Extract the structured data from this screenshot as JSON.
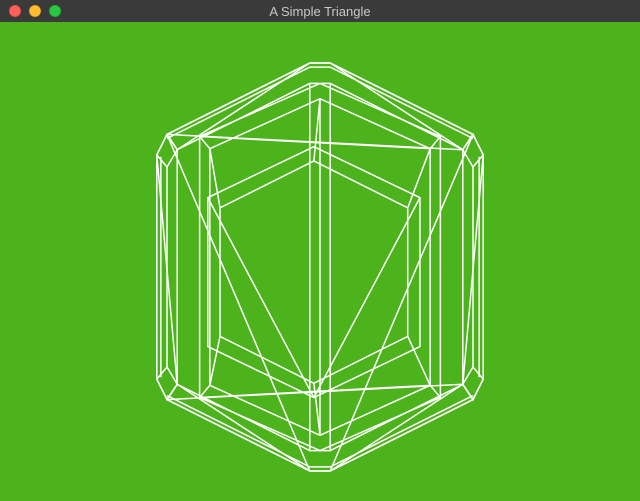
{
  "window": {
    "title": "A Simple Triangle",
    "close_name": "close",
    "minimize_name": "minimize",
    "zoom_name": "zoom"
  },
  "canvas": {
    "background": "#4cb31c",
    "wireframe_color": "#ffffff",
    "object": "beveled-cube-wireframe"
  }
}
